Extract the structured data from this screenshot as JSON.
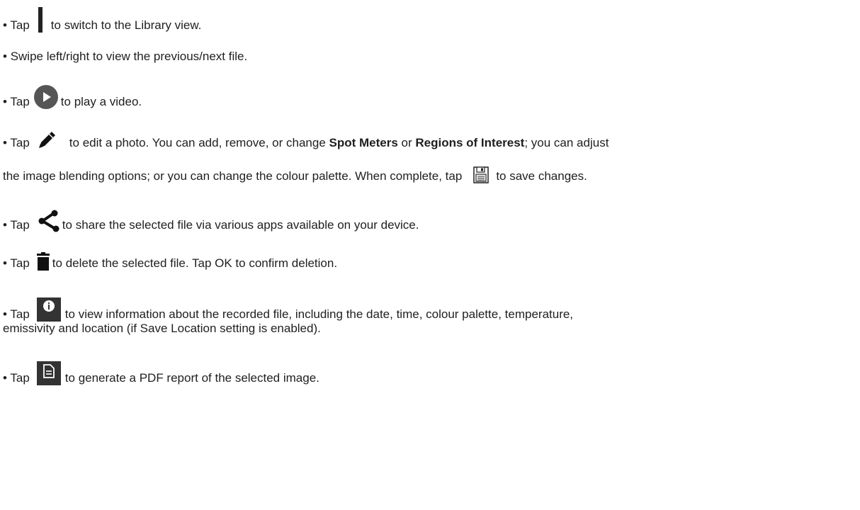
{
  "bullet": "•",
  "lines": {
    "library": {
      "tap": "Tap",
      "text": "to switch to the Library view."
    },
    "swipe": {
      "text": "Swipe left/right to view the previous/next file."
    },
    "play": {
      "tap": "Tap",
      "text": "to play a video."
    },
    "edit": {
      "tap": "Tap",
      "text_a": "to edit a photo. You can add, remove, or change ",
      "bold_a": "Spot Meters",
      "mid": " or ",
      "bold_b": "Regions of Interest",
      "text_b": "; you can adjust",
      "cont": "the image blending options; or you can change the colour palette. When complete, tap",
      "end": "to save changes."
    },
    "share": {
      "tap": "Tap",
      "text": "to share the selected file via various apps available on your device."
    },
    "delete": {
      "tap": "Tap",
      "text": "to delete the selected file. Tap OK to confirm deletion."
    },
    "info": {
      "tap": "Tap",
      "text": "to view information about the recorded file, including the date, time, colour palette, temperature,",
      "cont": "emissivity and location (if Save Location setting is enabled)."
    },
    "pdf": {
      "tap": "Tap",
      "text": "to generate a PDF report of the selected image."
    }
  },
  "icons": {
    "library": "grid-icon",
    "play": "play-icon",
    "edit": "pencil-icon",
    "save": "save-icon",
    "share": "share-icon",
    "delete": "trash-icon",
    "info": "info-icon",
    "pdf": "document-icon"
  }
}
